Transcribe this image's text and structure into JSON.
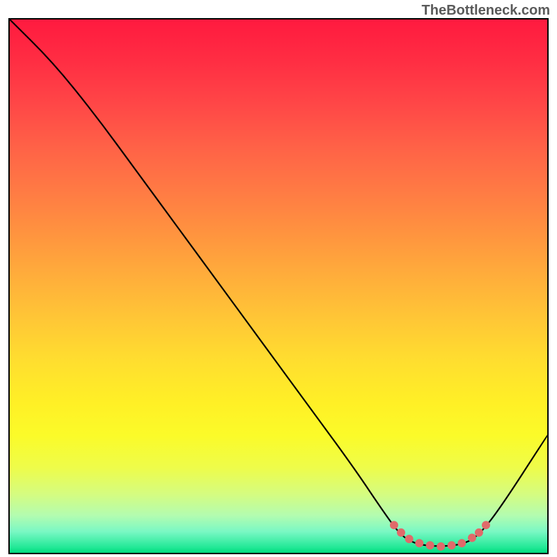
{
  "watermark": "TheBottleneck.com",
  "chart_data": {
    "type": "line",
    "title": "",
    "xlabel": "",
    "ylabel": "",
    "xlim": [
      0,
      100
    ],
    "ylim": [
      0,
      100
    ],
    "series": [
      {
        "name": "curve",
        "color": "#000000",
        "points": [
          {
            "x": 0,
            "y": 100
          },
          {
            "x": 8,
            "y": 92
          },
          {
            "x": 16,
            "y": 82
          },
          {
            "x": 24,
            "y": 71
          },
          {
            "x": 32,
            "y": 60
          },
          {
            "x": 40,
            "y": 49
          },
          {
            "x": 48,
            "y": 38
          },
          {
            "x": 56,
            "y": 27
          },
          {
            "x": 64,
            "y": 16
          },
          {
            "x": 70,
            "y": 7
          },
          {
            "x": 73,
            "y": 3
          },
          {
            "x": 76,
            "y": 1.5
          },
          {
            "x": 80,
            "y": 1.2
          },
          {
            "x": 84,
            "y": 1.5
          },
          {
            "x": 87,
            "y": 3
          },
          {
            "x": 91,
            "y": 8
          },
          {
            "x": 100,
            "y": 22
          }
        ]
      },
      {
        "name": "dots",
        "color": "#e06a6a",
        "points": [
          {
            "x": 71.5,
            "y": 5.2
          },
          {
            "x": 72.8,
            "y": 3.8
          },
          {
            "x": 74.3,
            "y": 2.6
          },
          {
            "x": 76.2,
            "y": 1.8
          },
          {
            "x": 78.2,
            "y": 1.4
          },
          {
            "x": 80.2,
            "y": 1.2
          },
          {
            "x": 82.2,
            "y": 1.4
          },
          {
            "x": 84.1,
            "y": 1.8
          },
          {
            "x": 86.0,
            "y": 2.8
          },
          {
            "x": 87.3,
            "y": 3.8
          },
          {
            "x": 88.6,
            "y": 5.2
          }
        ]
      }
    ],
    "gradient_stops": [
      {
        "pos": 0,
        "color": "#ff1a3f"
      },
      {
        "pos": 50,
        "color": "#ffc636"
      },
      {
        "pos": 80,
        "color": "#fbfb29"
      },
      {
        "pos": 100,
        "color": "#00d87e"
      }
    ]
  }
}
